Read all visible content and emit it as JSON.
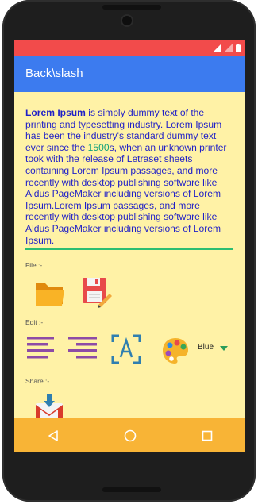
{
  "app": {
    "title": "Back\\slash"
  },
  "editor": {
    "text_bold": "Lorem Ipsum",
    "text_part1": " is simply dummy text of the printing and typesetting industry. Lorem Ipsum has been the industry's standard dummy text ever since the ",
    "text_link": "1500",
    "text_part2": "s, when an unknown printer took with the release of Letraset sheets containing Lorem Ipsum passages, and more recently with desktop publishing software like Aldus PageMaker including versions of Lorem Ipsum.Lorem Ipsum passages, and more recently with desktop publishing software like Aldus PageMaker including versions of Lorem Ipsum."
  },
  "sections": {
    "file_label": "File :-",
    "edit_label": "Edit :-",
    "share_label": "Share :-"
  },
  "color_picker": {
    "selected": "Blue"
  },
  "colors": {
    "statusbar": "#f24b4b",
    "appbar": "#3c7bef",
    "background": "#fff2a6",
    "navbar": "#f8b436",
    "text": "#1f1fc8"
  },
  "icons": {
    "file": [
      "open-folder-icon",
      "save-file-icon"
    ],
    "edit": [
      "align-left-icon",
      "align-right-icon",
      "text-format-icon",
      "palette-icon"
    ],
    "share": [
      "gmail-share-icon"
    ],
    "nav": [
      "back-nav-icon",
      "home-nav-icon",
      "recents-nav-icon"
    ]
  }
}
